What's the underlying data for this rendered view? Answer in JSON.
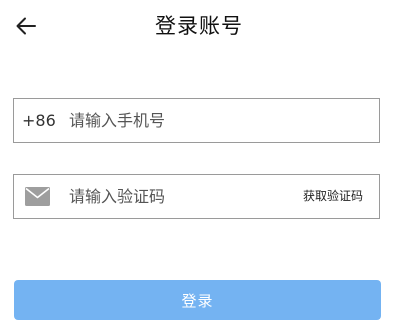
{
  "header": {
    "back_icon": "arrow-left-icon",
    "title": "登录账号"
  },
  "phone": {
    "country_code": "+86",
    "placeholder": "请输入手机号",
    "value": ""
  },
  "code": {
    "icon": "mail-icon",
    "placeholder": "请输入验证码",
    "value": "",
    "get_code_label": "获取验证码"
  },
  "login": {
    "label": "登录",
    "color": "#74b3f2"
  }
}
